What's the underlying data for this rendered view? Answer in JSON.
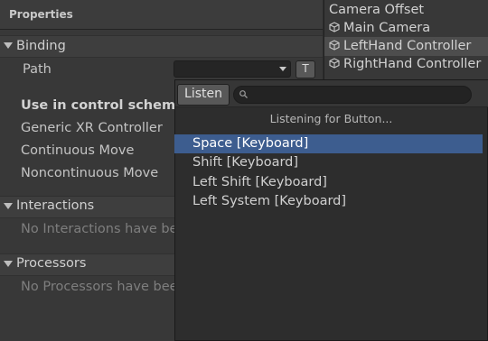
{
  "properties": {
    "title": "Properties",
    "binding": {
      "section": "Binding",
      "path_label": "Path",
      "path_button": "T",
      "control_scheme_header": "Use in control scheme",
      "schemes": [
        "Generic XR Controller",
        "Continuous Move",
        "Noncontinuous Move"
      ]
    },
    "interactions": {
      "section": "Interactions",
      "empty": "No Interactions have bee"
    },
    "processors": {
      "section": "Processors",
      "empty": "No Processors have bee"
    }
  },
  "hierarchy": {
    "items": [
      {
        "label": "Camera Offset",
        "icon": ""
      },
      {
        "label": "Main Camera",
        "icon": "gameobject-cube-icon"
      },
      {
        "label": "LeftHand Controller",
        "icon": "gameobject-cube-icon",
        "selected": true
      },
      {
        "label": "RightHand Controller",
        "icon": "gameobject-cube-icon"
      }
    ]
  },
  "dropdown": {
    "listen_button": "Listen",
    "search_placeholder": "",
    "status": "Listening for Button...",
    "items": [
      "Space [Keyboard]",
      "Shift [Keyboard]",
      "Left Shift [Keyboard]",
      "Left System [Keyboard]"
    ],
    "selected_index": 0
  },
  "colors": {
    "selection": "#3d5d8f",
    "panel": "#383838",
    "background": "#2d2d2d"
  }
}
